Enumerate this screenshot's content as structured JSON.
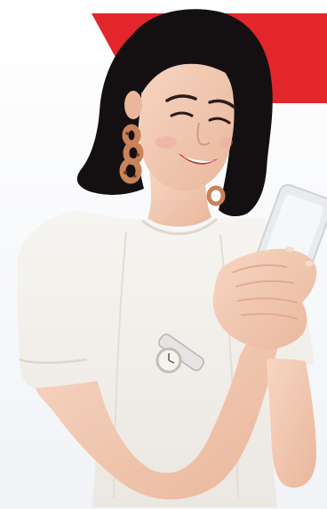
{
  "image": {
    "alt": "",
    "colors": {
      "background": "#ffffff",
      "accent": "#e3262b",
      "hair": "#141012",
      "skin": "#f2c8b0",
      "top": "#f4f1ec",
      "phone": "#e9ebee",
      "earring": "#c9825a",
      "watch_band": "#e6e4e2"
    }
  }
}
